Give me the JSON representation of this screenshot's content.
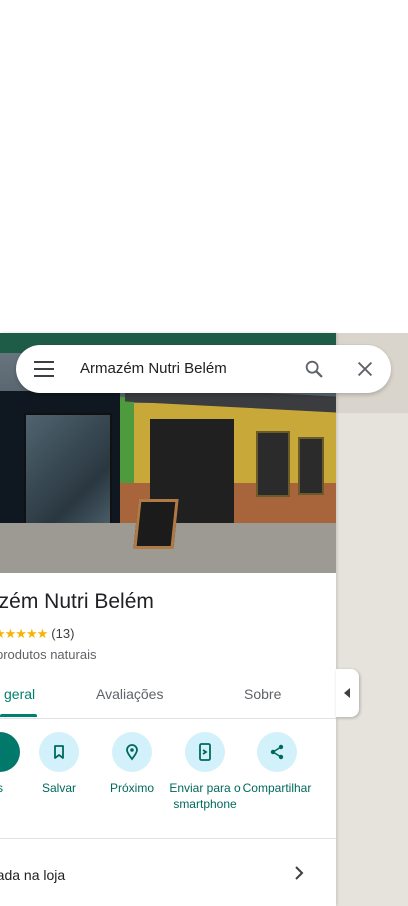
{
  "search": {
    "query": "Armazém Nutri Belém"
  },
  "place": {
    "name": "azém Nutri Belém",
    "rating_count": "(13)",
    "stars": "★★★★★",
    "rating": 4.5,
    "category": "produtos naturais"
  },
  "tabs": [
    {
      "label": "geral"
    },
    {
      "label": "Avaliações"
    },
    {
      "label": "Sobre"
    }
  ],
  "actions": [
    {
      "label": "s",
      "icon": "directions-icon"
    },
    {
      "label": "Salvar",
      "icon": "bookmark-icon"
    },
    {
      "label": "Próximo",
      "icon": "nearby-icon"
    },
    {
      "label": "Enviar para o smartphone",
      "icon": "send-to-phone-icon"
    },
    {
      "label": "Compartilhar",
      "icon": "share-icon"
    }
  ],
  "info_row": {
    "text": "rada na loja"
  },
  "colors": {
    "accent": "#00806e",
    "action_bg": "#d3f1fa",
    "star": "#f4b400"
  }
}
